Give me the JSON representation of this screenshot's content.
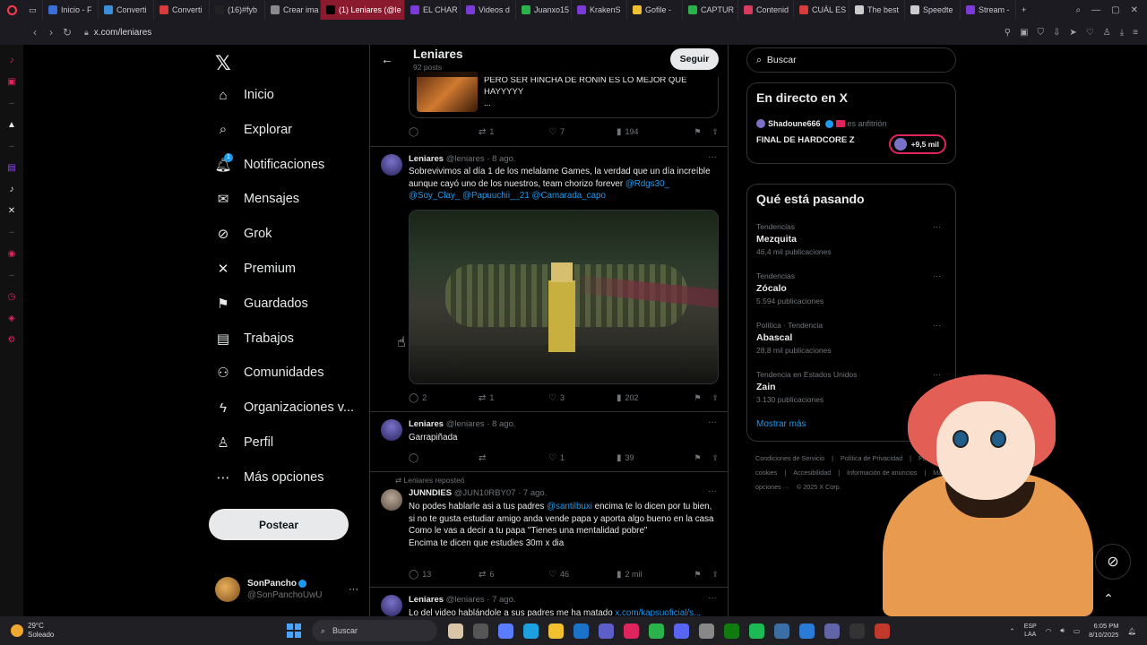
{
  "browser": {
    "tabs": [
      {
        "label": "Inicio - F",
        "color": "#3b6fd8"
      },
      {
        "label": "Converti",
        "color": "#3b8fd8"
      },
      {
        "label": "Converti",
        "color": "#d83b3b"
      },
      {
        "label": "(16)#fyb",
        "color": "#222222"
      },
      {
        "label": "Crear ima",
        "color": "#8a8a8a"
      },
      {
        "label": "(1) Leniares (@le",
        "color": "#000000",
        "active": true
      },
      {
        "label": "EL CHAR",
        "color": "#7a3bd8"
      },
      {
        "label": "Videos d",
        "color": "#7a3bd8"
      },
      {
        "label": "Juanxo15",
        "color": "#2bb24a"
      },
      {
        "label": "KrakenS",
        "color": "#7a3bd8"
      },
      {
        "label": "Gofile - ",
        "color": "#f0c030"
      },
      {
        "label": "CAPTUR",
        "color": "#2bb24a"
      },
      {
        "label": "Contenid",
        "color": "#d83b5e"
      },
      {
        "label": "CUÁL ES",
        "color": "#d83b3b"
      },
      {
        "label": "The best",
        "color": "#cccccc"
      },
      {
        "label": "Speedte",
        "color": "#cccccc"
      },
      {
        "label": "Stream -",
        "color": "#7a3bd8"
      }
    ],
    "url": "x.com/leniares"
  },
  "nav": {
    "items": [
      {
        "label": "Inicio",
        "icon": "⌂"
      },
      {
        "label": "Explorar",
        "icon": "⌕"
      },
      {
        "label": "Notificaciones",
        "icon": "🔔︎"
      },
      {
        "label": "Mensajes",
        "icon": "✉"
      },
      {
        "label": "Grok",
        "icon": "⊘"
      },
      {
        "label": "Premium",
        "icon": "✕"
      },
      {
        "label": "Guardados",
        "icon": "⚑"
      },
      {
        "label": "Trabajos",
        "icon": "▤"
      },
      {
        "label": "Comunidades",
        "icon": "⚇"
      },
      {
        "label": "Organizaciones v...",
        "icon": "ϟ"
      },
      {
        "label": "Perfil",
        "icon": "♙"
      },
      {
        "label": "Más opciones",
        "icon": "⋯"
      }
    ],
    "notif_count": "1",
    "post_label": "Postear",
    "account": {
      "name": "SonPancho",
      "handle": "@SonPanchoUwU"
    }
  },
  "profile_header": {
    "title": "Leniares",
    "subtitle": "92 posts",
    "follow_label": "Seguir"
  },
  "quote": {
    "text": "PERO SER HINCHA DE RONIN ES LO MEJOR QUE HAYYYYY",
    "ellipsis": "..."
  },
  "tweets": [
    {
      "replies": "",
      "retweets": "1",
      "likes": "7",
      "views": "194"
    },
    {
      "author": "Leniares",
      "handle": "@leniares",
      "time": "· 8 ago.",
      "text": "Sobrevivimos al día 1 de los melalame Games, la verdad que un día increíble aunque cayó uno de los nuestros, team chorizo forever ",
      "mentions": "@Rdgs30_ @Soy_Clay_ @Papuuchii__21 @Camarada_capo",
      "replies": "2",
      "retweets": "1",
      "likes": "3",
      "views": "202"
    },
    {
      "author": "Leniares",
      "handle": "@leniares",
      "time": "· 8 ago.",
      "text": "Garrapiñada",
      "replies": "",
      "retweets": "",
      "likes": "1",
      "views": "39"
    },
    {
      "repost_label": "Leniares reposteó",
      "author": "JUNNDIES",
      "handle": "@JUN10RBY07",
      "time": "· 7 ago.",
      "line1_a": "No podes hablarle asi a tus padres ",
      "line1_mention": "@santilbuxi",
      "line1_b": " encima te lo dicen por tu bien, si no te gusta estudiar amigo anda vende papa y aporta algo bueno en la casa",
      "line2": "Como le vas a decir a tu papa \"Tienes una mentalidad pobre\"",
      "line3": "Encima te dicen que estudies 30m x dia",
      "replies": "13",
      "retweets": "6",
      "likes": "46",
      "views": "2 mil"
    },
    {
      "author": "Leniares",
      "handle": "@leniares",
      "time": "· 7 ago.",
      "text": "Lo del video hablándole a sus padres me ha matado ",
      "link": "x.com/kapsuoficial/s..."
    }
  ],
  "right": {
    "search_placeholder": "Buscar",
    "live": {
      "title": "En directo en X",
      "host": "Shadoune666",
      "host_suffix": "es anfitrión",
      "stream_title": "FINAL DE HARDCORE Z",
      "viewers": "+9,5 mil"
    },
    "trends_title": "Qué está pasando",
    "trends": [
      {
        "meta": "Tendencias",
        "name": "Mezquita",
        "count": "46,4 mil publicaciones"
      },
      {
        "meta": "Tendencias",
        "name": "Zócalo",
        "count": "5.594 publicaciones"
      },
      {
        "meta": "Política · Tendencia",
        "name": "Abascal",
        "count": "28,8 mil publicaciones"
      },
      {
        "meta": "Tendencia en Estados Unidos",
        "name": "Zain",
        "count": "3.130 publicaciones"
      }
    ],
    "show_more": "Mostrar más",
    "footer": [
      "Condiciones de Servicio",
      "|",
      "Política de Privacidad",
      "|",
      "Política de cookies",
      "|",
      "Accesibilidad",
      "|",
      "Información de anuncios",
      "|",
      "Más opciones ···",
      "© 2025 X Corp."
    ]
  },
  "taskbar": {
    "temp": "29°C",
    "weather": "Soleado",
    "search_placeholder": "Buscar",
    "lang1": "ESP",
    "lang2": "LAA",
    "time": "6:05 PM",
    "date": "8/10/2025"
  }
}
